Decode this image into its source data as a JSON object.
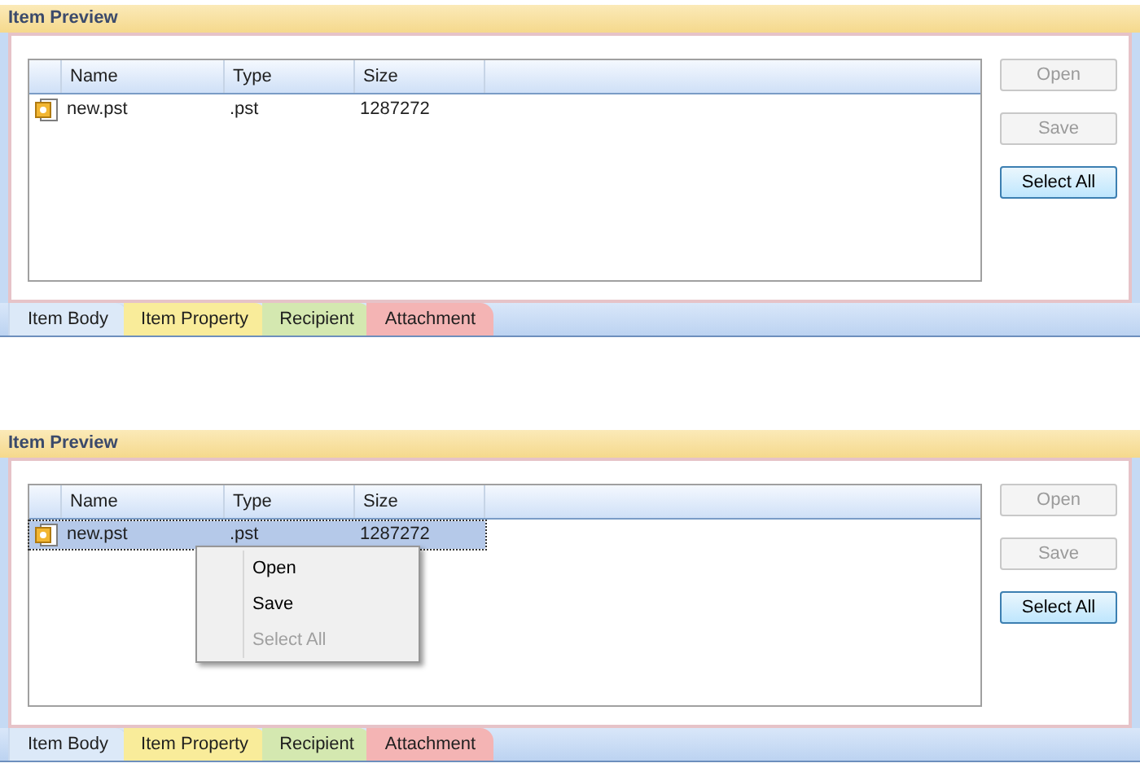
{
  "panels": [
    {
      "title": "Item Preview",
      "columns": [
        "Name",
        "Type",
        "Size"
      ],
      "rows": [
        {
          "name": "new.pst",
          "type": ".pst",
          "size": "1287272",
          "selected": false
        }
      ],
      "buttons": [
        {
          "label": "Open",
          "disabled": true
        },
        {
          "label": "Save",
          "disabled": true
        },
        {
          "label": "Select All",
          "disabled": false
        }
      ],
      "tabs": [
        {
          "label": "Item Body",
          "selected": true,
          "color": "#dce9f8"
        },
        {
          "label": "Item Property",
          "selected": false,
          "color": "#f9ec9a"
        },
        {
          "label": "Recipient",
          "selected": false,
          "color": "#d4e8b0"
        },
        {
          "label": "Attachment",
          "selected": false,
          "color": "#f4b4b4"
        }
      ]
    },
    {
      "title": "Item Preview",
      "columns": [
        "Name",
        "Type",
        "Size"
      ],
      "rows": [
        {
          "name": "new.pst",
          "type": ".pst",
          "size": "1287272",
          "selected": true
        }
      ],
      "context_menu": [
        {
          "label": "Open",
          "disabled": false
        },
        {
          "label": "Save",
          "disabled": false
        },
        {
          "label": "Select All",
          "disabled": true
        }
      ],
      "buttons": [
        {
          "label": "Open",
          "disabled": true
        },
        {
          "label": "Save",
          "disabled": true
        },
        {
          "label": "Select All",
          "disabled": false
        }
      ],
      "tabs": [
        {
          "label": "Item Body",
          "selected": true,
          "color": "#dce9f8"
        },
        {
          "label": "Item Property",
          "selected": false,
          "color": "#f9ec9a"
        },
        {
          "label": "Recipient",
          "selected": false,
          "color": "#d4e8b0"
        },
        {
          "label": "Attachment",
          "selected": false,
          "color": "#f4b4b4"
        }
      ]
    }
  ]
}
